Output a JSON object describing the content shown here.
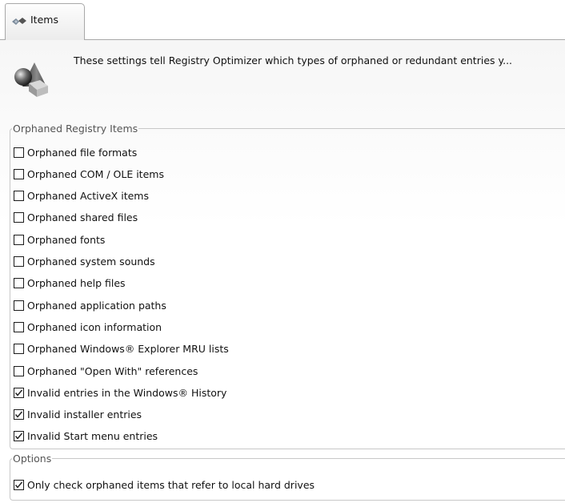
{
  "tabs": [
    {
      "label": "Items",
      "icon": "registry-items-icon",
      "selected": true
    }
  ],
  "header": {
    "icon": "shapes-icon",
    "description": "These settings tell Registry Optimizer which types of orphaned or redundant entries y..."
  },
  "orphaned_group": {
    "title": "Orphaned Registry Items",
    "items": [
      {
        "label": "Orphaned file formats",
        "checked": false
      },
      {
        "label": "Orphaned COM / OLE items",
        "checked": false
      },
      {
        "label": "Orphaned ActiveX items",
        "checked": false
      },
      {
        "label": "Orphaned shared files",
        "checked": false
      },
      {
        "label": "Orphaned fonts",
        "checked": false
      },
      {
        "label": "Orphaned system sounds",
        "checked": false
      },
      {
        "label": "Orphaned help files",
        "checked": false
      },
      {
        "label": "Orphaned application paths",
        "checked": false
      },
      {
        "label": "Orphaned icon information",
        "checked": false
      },
      {
        "label": "Orphaned Windows® Explorer MRU lists",
        "checked": false
      },
      {
        "label": "Orphaned \"Open With\" references",
        "checked": false
      },
      {
        "label": "Invalid entries in the Windows® History",
        "checked": true
      },
      {
        "label": "Invalid installer entries",
        "checked": true
      },
      {
        "label": "Invalid Start menu entries",
        "checked": true
      }
    ]
  },
  "options_group": {
    "title": "Options",
    "items": [
      {
        "label": "Only check orphaned items that refer to local hard drives",
        "checked": true
      }
    ]
  }
}
